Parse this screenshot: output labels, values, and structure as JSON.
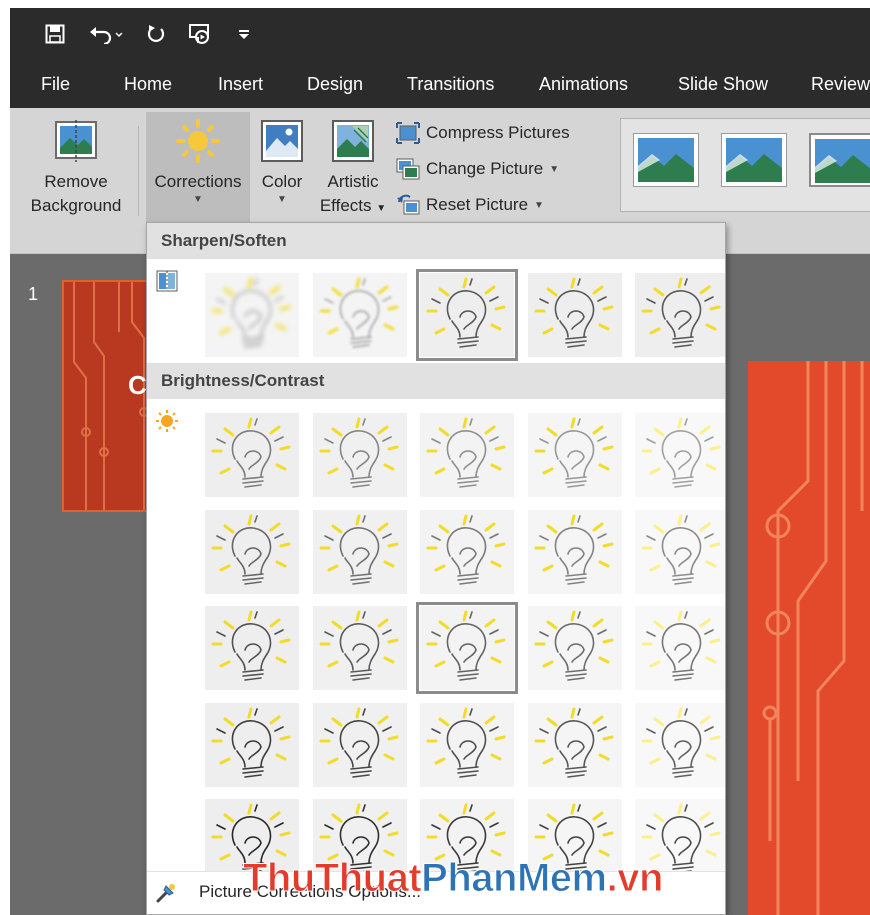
{
  "quick_access": {
    "items": [
      "save-icon",
      "undo-icon",
      "redo-icon",
      "present-from-start-icon",
      "customize-qat-icon"
    ]
  },
  "tabs": [
    "File",
    "Home",
    "Insert",
    "Design",
    "Transitions",
    "Animations",
    "Slide Show",
    "Review"
  ],
  "ribbon": {
    "remove_background": {
      "line1": "Remove",
      "line2": "Background"
    },
    "corrections": {
      "label": "Corrections"
    },
    "color": {
      "label": "Color"
    },
    "artistic_effects": {
      "line1": "Artistic",
      "line2": "Effects"
    },
    "compress_pictures": "Compress Pictures",
    "change_picture": "Change Picture",
    "reset_picture": "Reset Picture"
  },
  "slides_pane": {
    "slide_number": "1"
  },
  "corrections_menu": {
    "sharpen_soften": {
      "header": "Sharpen/Soften",
      "selected_index": 2,
      "count": 5
    },
    "brightness_contrast": {
      "header": "Brightness/Contrast",
      "rows": 5,
      "cols": 5,
      "selected_row": 2,
      "selected_col": 2
    },
    "footer_label": "Picture Corrections Options..."
  },
  "watermark": {
    "part1": "ThuThuat",
    "part2": "PhanMem",
    "part3": ".vn"
  },
  "colors": {
    "title_bar": "#2b2b2b",
    "ribbon": "#d5d5d5",
    "slide_red": "#e24a2b",
    "sun_yellow": "#f5c93b"
  }
}
